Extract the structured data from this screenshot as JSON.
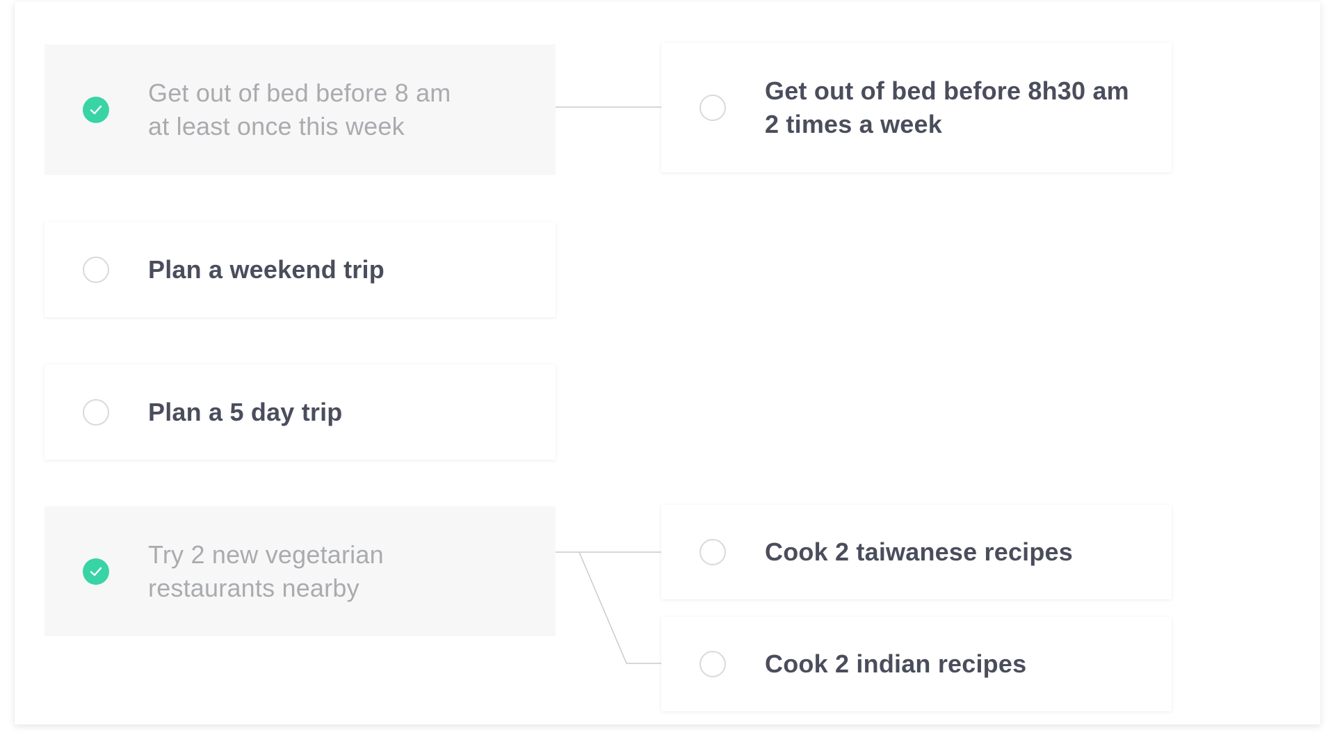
{
  "colors": {
    "accent": "#38d4a5",
    "text_active": "#4a4d5c",
    "text_done": "#a9abaf",
    "card_done_bg": "#f7f7f7",
    "line": "#c8cacd",
    "ring": "#d7d9dd"
  },
  "goals": [
    {
      "id": "bed-8am",
      "completed": true,
      "icon": "checkmark-icon",
      "lines": [
        "Get out of bed before 8 am",
        "at least once this week"
      ]
    },
    {
      "id": "weekend-trip",
      "completed": false,
      "icon": "empty-circle-icon",
      "lines": [
        "Plan a weekend trip"
      ]
    },
    {
      "id": "5-day-trip",
      "completed": false,
      "icon": "empty-circle-icon",
      "lines": [
        "Plan a 5 day trip"
      ]
    },
    {
      "id": "veg-restaurants",
      "completed": true,
      "icon": "checkmark-icon",
      "lines": [
        "Try 2 new vegetarian",
        "restaurants nearby"
      ]
    }
  ],
  "next_goals": [
    {
      "id": "bed-830am",
      "parent": "bed-8am",
      "completed": false,
      "icon": "empty-circle-icon",
      "lines": [
        "Get out of bed before 8h30 am",
        "2 times a week"
      ]
    },
    {
      "id": "taiwanese-recipes",
      "parent": "veg-restaurants",
      "completed": false,
      "icon": "empty-circle-icon",
      "lines": [
        "Cook 2 taiwanese recipes"
      ]
    },
    {
      "id": "indian-recipes",
      "parent": "veg-restaurants",
      "completed": false,
      "icon": "empty-circle-icon",
      "lines": [
        "Cook 2 indian recipes"
      ]
    }
  ]
}
